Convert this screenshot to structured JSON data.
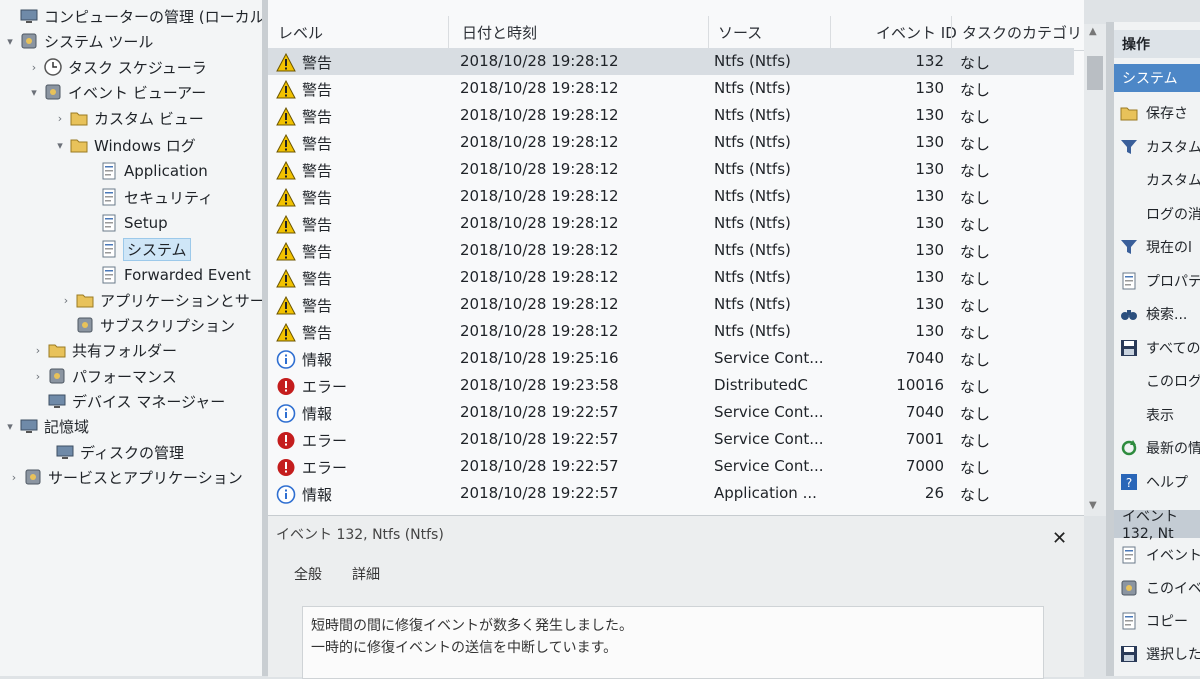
{
  "tree": {
    "items": [
      {
        "label": "コンピューターの管理 (ローカル)",
        "arrow": "",
        "icon": "computer-icon"
      },
      {
        "label": "システム ツール",
        "arrow": "▾",
        "icon": "tools-icon"
      },
      {
        "label": "タスク スケジューラ",
        "arrow": "›",
        "icon": "clock-icon"
      },
      {
        "label": "イベント ビューアー",
        "arrow": "▾",
        "icon": "event-viewer-icon"
      },
      {
        "label": "カスタム ビュー",
        "arrow": "›",
        "icon": "folder-icon"
      },
      {
        "label": "Windows ログ",
        "arrow": "▾",
        "icon": "folder-icon"
      },
      {
        "label": "Application",
        "arrow": "",
        "icon": "log-icon"
      },
      {
        "label": "セキュリティ",
        "arrow": "",
        "icon": "log-icon"
      },
      {
        "label": "Setup",
        "arrow": "",
        "icon": "log-icon"
      },
      {
        "label": "システム",
        "arrow": "",
        "icon": "log-icon"
      },
      {
        "label": "Forwarded Event",
        "arrow": "",
        "icon": "log-icon"
      },
      {
        "label": "アプリケーションとサービス",
        "arrow": "›",
        "icon": "folder-icon"
      },
      {
        "label": "サブスクリプション",
        "arrow": "",
        "icon": "subscription-icon"
      },
      {
        "label": "共有フォルダー",
        "arrow": "›",
        "icon": "shared-folder-icon"
      },
      {
        "label": "パフォーマンス",
        "arrow": "›",
        "icon": "performance-icon"
      },
      {
        "label": "デバイス マネージャー",
        "arrow": "",
        "icon": "device-manager-icon"
      },
      {
        "label": "記憶域",
        "arrow": "▾",
        "icon": "storage-icon"
      },
      {
        "label": "ディスクの管理",
        "arrow": "",
        "icon": "disk-icon"
      },
      {
        "label": "サービスとアプリケーション",
        "arrow": "›",
        "icon": "services-icon"
      }
    ]
  },
  "columns": {
    "level": "レベル",
    "datetime": "日付と時刻",
    "source": "ソース",
    "event_id": "イベント ID",
    "task": "タスクのカテゴリ"
  },
  "rows": [
    {
      "kind": "warn",
      "level": "警告",
      "datetime": "2018/10/28 19:28:12",
      "source": "Ntfs (Ntfs)",
      "id": "132",
      "task": "なし"
    },
    {
      "kind": "warn",
      "level": "警告",
      "datetime": "2018/10/28 19:28:12",
      "source": "Ntfs (Ntfs)",
      "id": "130",
      "task": "なし"
    },
    {
      "kind": "warn",
      "level": "警告",
      "datetime": "2018/10/28 19:28:12",
      "source": "Ntfs (Ntfs)",
      "id": "130",
      "task": "なし"
    },
    {
      "kind": "warn",
      "level": "警告",
      "datetime": "2018/10/28 19:28:12",
      "source": "Ntfs (Ntfs)",
      "id": "130",
      "task": "なし"
    },
    {
      "kind": "warn",
      "level": "警告",
      "datetime": "2018/10/28 19:28:12",
      "source": "Ntfs (Ntfs)",
      "id": "130",
      "task": "なし"
    },
    {
      "kind": "warn",
      "level": "警告",
      "datetime": "2018/10/28 19:28:12",
      "source": "Ntfs (Ntfs)",
      "id": "130",
      "task": "なし"
    },
    {
      "kind": "warn",
      "level": "警告",
      "datetime": "2018/10/28 19:28:12",
      "source": "Ntfs (Ntfs)",
      "id": "130",
      "task": "なし"
    },
    {
      "kind": "warn",
      "level": "警告",
      "datetime": "2018/10/28 19:28:12",
      "source": "Ntfs (Ntfs)",
      "id": "130",
      "task": "なし"
    },
    {
      "kind": "warn",
      "level": "警告",
      "datetime": "2018/10/28 19:28:12",
      "source": "Ntfs (Ntfs)",
      "id": "130",
      "task": "なし"
    },
    {
      "kind": "warn",
      "level": "警告",
      "datetime": "2018/10/28 19:28:12",
      "source": "Ntfs (Ntfs)",
      "id": "130",
      "task": "なし"
    },
    {
      "kind": "warn",
      "level": "警告",
      "datetime": "2018/10/28 19:28:12",
      "source": "Ntfs (Ntfs)",
      "id": "130",
      "task": "なし"
    },
    {
      "kind": "info",
      "level": "情報",
      "datetime": "2018/10/28 19:25:16",
      "source": "Service Cont...",
      "id": "7040",
      "task": "なし"
    },
    {
      "kind": "error",
      "level": "エラー",
      "datetime": "2018/10/28 19:23:58",
      "source": "DistributedC",
      "id": "10016",
      "task": "なし"
    },
    {
      "kind": "info",
      "level": "情報",
      "datetime": "2018/10/28 19:22:57",
      "source": "Service Cont...",
      "id": "7040",
      "task": "なし"
    },
    {
      "kind": "error",
      "level": "エラー",
      "datetime": "2018/10/28 19:22:57",
      "source": "Service Cont...",
      "id": "7001",
      "task": "なし"
    },
    {
      "kind": "error",
      "level": "エラー",
      "datetime": "2018/10/28 19:22:57",
      "source": "Service Cont...",
      "id": "7000",
      "task": "なし"
    },
    {
      "kind": "info",
      "level": "情報",
      "datetime": "2018/10/28 19:22:57",
      "source": "Application ...",
      "id": "26",
      "task": "なし"
    }
  ],
  "detail": {
    "title": "イベント 132, Ntfs (Ntfs)",
    "close": "✕",
    "tab_general": "全般",
    "tab_details": "詳細",
    "message_line1": "短時間の間に修復イベントが数多く発生しました。",
    "message_line2": "一時的に修復イベントの送信を中断しています。"
  },
  "actions": {
    "header": "操作",
    "section1": "システム",
    "items": [
      {
        "label": "保存さ",
        "icon": "open-folder-icon"
      },
      {
        "label": "カスタム",
        "icon": "filter-icon"
      },
      {
        "label": "カスタム",
        "icon": ""
      },
      {
        "label": "ログの消",
        "icon": ""
      },
      {
        "label": "現在のl",
        "icon": "filter-icon"
      },
      {
        "label": "プロパティ",
        "icon": "properties-icon"
      },
      {
        "label": "検索...",
        "icon": "binoculars-icon"
      },
      {
        "label": "すべての",
        "icon": "save-icon"
      },
      {
        "label": "このログに",
        "icon": ""
      },
      {
        "label": "表示",
        "icon": ""
      },
      {
        "label": "最新の情",
        "icon": "refresh-icon"
      },
      {
        "label": "ヘルプ",
        "icon": "help-icon"
      }
    ],
    "section2": "イベント 132, Nt",
    "items2": [
      {
        "label": "イベントのプ",
        "icon": "event-properties-icon"
      },
      {
        "label": "このイベント",
        "icon": "attach-task-icon"
      },
      {
        "label": "コピー",
        "icon": "copy-icon"
      },
      {
        "label": "選択したイ",
        "icon": "save-icon"
      }
    ]
  },
  "colors": {
    "warn": "#f2c200",
    "info": "#2f6fd1",
    "error": "#c41d1d",
    "selection": "#cfe6f7"
  }
}
